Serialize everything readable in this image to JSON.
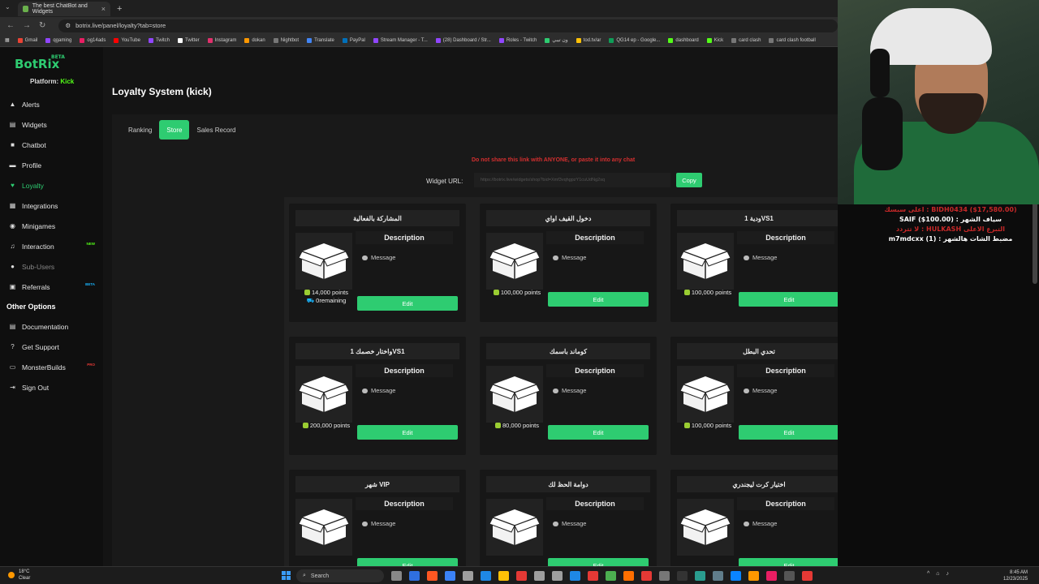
{
  "browser": {
    "tab_title": "The best ChatBot and Widgets",
    "url": "botrix.live/panel/loyalty?tab=store",
    "bookmarks": [
      "Gmail",
      "qgaming",
      "og14ads",
      "YouTube",
      "Twitch",
      "Twitter",
      "Instagram",
      "dokan",
      "Nightbot",
      "Translate",
      "PayPal",
      "Stream Manager - T...",
      "(28) Dashboard / Str...",
      "Roles - Twitch",
      "ون تيبي",
      "tod.tv/ar",
      "QG14 ep - Google...",
      "dashboard",
      "Kick",
      "card clash",
      "card clash football"
    ]
  },
  "sidebar": {
    "logo": "BotRix",
    "logo_badge": "BETA",
    "platform_label": "Platform:",
    "platform_value": "Kick",
    "items": [
      {
        "label": "Alerts",
        "icon": "alert-icon"
      },
      {
        "label": "Widgets",
        "icon": "widgets-icon"
      },
      {
        "label": "Chatbot",
        "icon": "chat-icon"
      },
      {
        "label": "Profile",
        "icon": "profile-icon"
      },
      {
        "label": "Loyalty",
        "icon": "heart-icon"
      },
      {
        "label": "Integrations",
        "icon": "integrations-icon"
      },
      {
        "label": "Minigames",
        "icon": "gamepad-icon"
      },
      {
        "label": "Interaction",
        "icon": "music-icon",
        "badge": "NEW"
      },
      {
        "label": "Sub-Users",
        "icon": "users-icon"
      },
      {
        "label": "Referrals",
        "icon": "referrals-icon",
        "badge": "BETA"
      }
    ],
    "other_heading": "Other Options",
    "other_items": [
      {
        "label": "Documentation",
        "icon": "document-icon"
      },
      {
        "label": "Get Support",
        "icon": "help-icon"
      },
      {
        "label": "MonsterBuilds",
        "icon": "monitor-icon",
        "badge": "PRO"
      },
      {
        "label": "Sign Out",
        "icon": "signout-icon"
      }
    ]
  },
  "main": {
    "title": "Loyalty System (kick)",
    "tabs": [
      "Ranking",
      "Store",
      "Sales Record"
    ],
    "active_tab": "Store",
    "warning": "Do not share this link with ANYONE, or paste it into any chat",
    "widget_url_label": "Widget URL:",
    "widget_url_value": "https://botrix.live/widgets/shop?bid=Xmf3vqhgpzY1cuUdNg2sq",
    "copy_label": "Copy"
  },
  "store_items": [
    {
      "title": "المشاركة بالفعالية",
      "description": "Description",
      "message": "Message",
      "points": "14,000 points",
      "remaining": "0remaining",
      "edit": "Edit"
    },
    {
      "title": "دخول القيف اواي",
      "description": "Description",
      "message": "Message",
      "points": "100,000 points",
      "edit": "Edit"
    },
    {
      "title": "ودية 1VS1",
      "description": "Description",
      "message": "Message",
      "points": "100,000 points",
      "edit": "Edit"
    },
    {
      "title": "واختار خصمك 1VS1",
      "description": "Description",
      "message": "Message",
      "points": "200,000 points",
      "edit": "Edit"
    },
    {
      "title": "كوماند باسمك",
      "description": "Description",
      "message": "Message",
      "points": "80,000 points",
      "edit": "Edit"
    },
    {
      "title": "تحدي البطل",
      "description": "Description",
      "message": "Message",
      "points": "100,000 points",
      "edit": "Edit"
    },
    {
      "title": "شهر VIP",
      "description": "Description",
      "message": "Message",
      "points": "",
      "edit": "Edit"
    },
    {
      "title": "دوامة الحظ لك",
      "description": "Description",
      "message": "Message",
      "points": "",
      "edit": "Edit"
    },
    {
      "title": "اختيار كرت ليجندري",
      "description": "Description",
      "message": "Message",
      "points": "",
      "edit": "Edit"
    }
  ],
  "overlay": {
    "lines": [
      "اعلى سبسك : BIDH0434 ($17,580.00)",
      "SAIF ($100.00) : سياف الشهر",
      "لا تتردد : HULKASH التبرع الاعلى",
      "m7mdcxx (1) : مضبط الشات هالشهر"
    ]
  },
  "taskbar": {
    "temp": "18°C",
    "weather": "Clear",
    "search": "Search",
    "time": "8:45 AM",
    "date": "12/23/2025"
  }
}
